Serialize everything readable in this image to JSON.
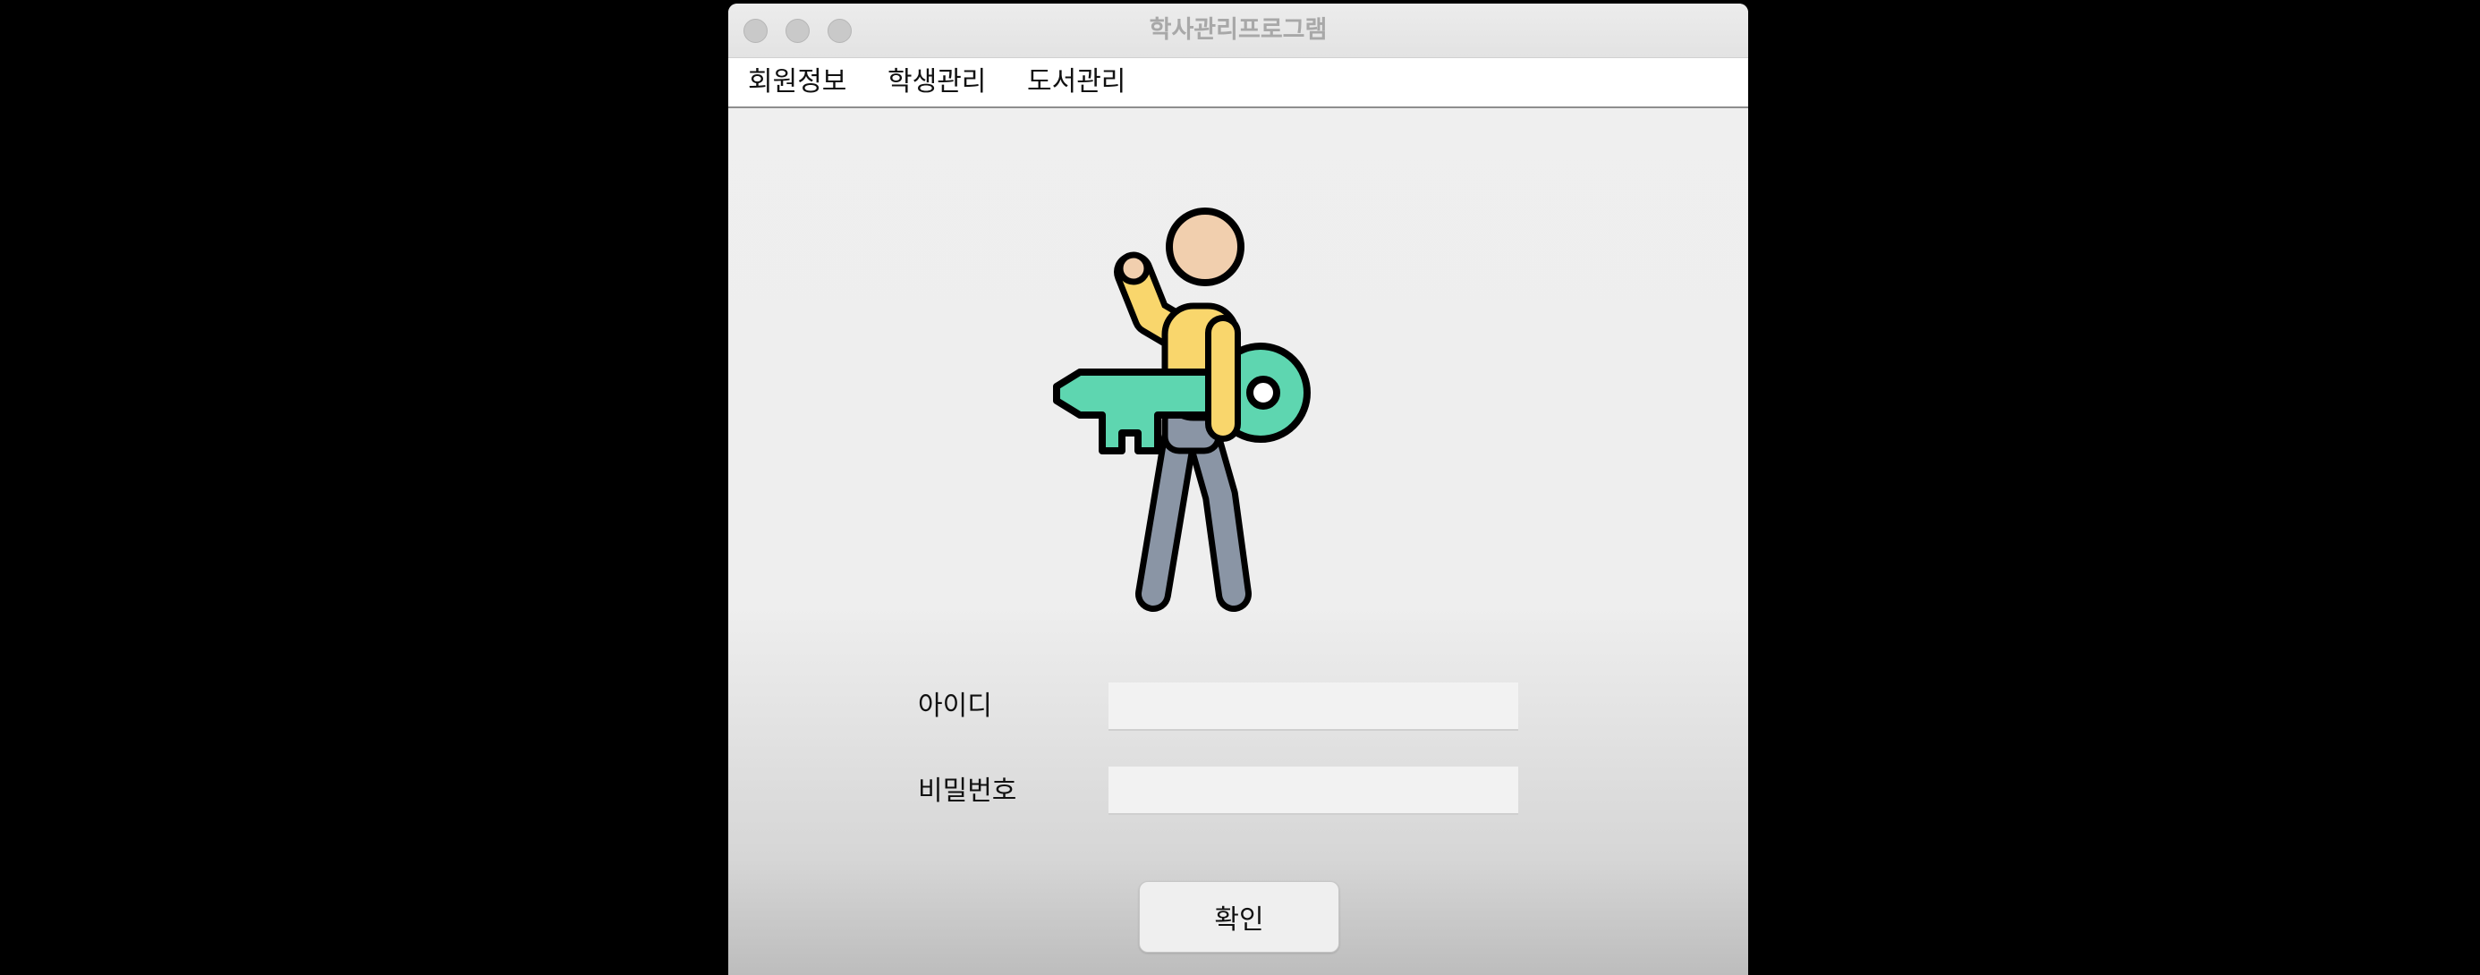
{
  "window": {
    "title": "학사관리프로그램"
  },
  "menu": {
    "items": [
      {
        "label": "회원정보"
      },
      {
        "label": "학생관리"
      },
      {
        "label": "도서관리"
      }
    ]
  },
  "illustration": {
    "icon": "person-holding-key-icon",
    "colors": {
      "skin": "#f1cfae",
      "shirt": "#f9d66c",
      "key": "#5ed6b0",
      "pants": "#8a95a5",
      "outline": "#000000"
    }
  },
  "login_form": {
    "id_label": "아이디",
    "id_value": "",
    "password_label": "비밀번호",
    "password_value": "",
    "confirm_label": "확인"
  }
}
